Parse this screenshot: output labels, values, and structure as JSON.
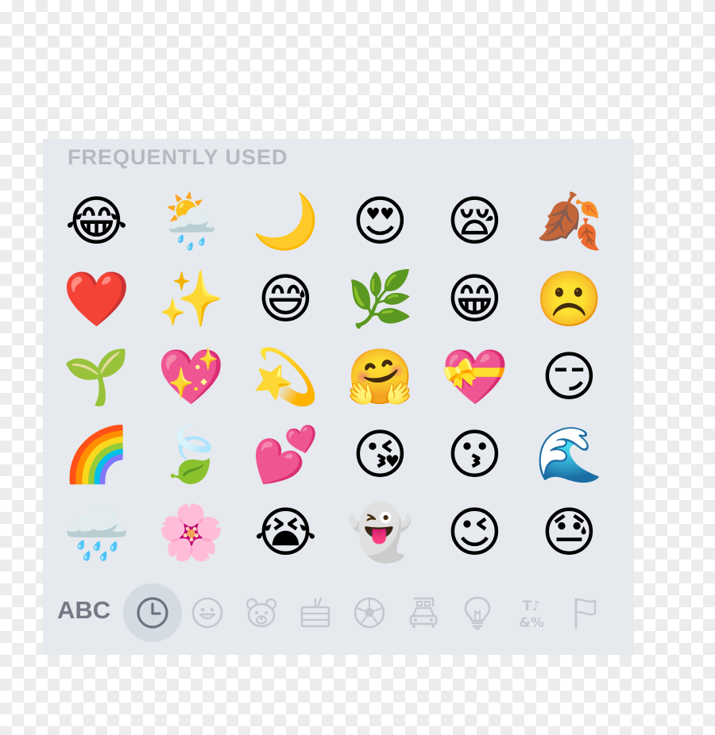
{
  "keyboard": {
    "section_title": "FREQUENTLY USED",
    "emoji_rows": [
      [
        {
          "char": "😂",
          "name": "face-with-tears-of-joy"
        },
        {
          "char": "🌦️",
          "name": "sun-behind-rain-cloud"
        },
        {
          "char": "🌙",
          "name": "crescent-moon"
        },
        {
          "char": "😍",
          "name": "smiling-face-with-heart-eyes"
        },
        {
          "char": "😪",
          "name": "sleepy-face"
        },
        {
          "char": "🍂",
          "name": "fallen-leaf"
        }
      ],
      [
        {
          "char": "❤️",
          "name": "red-heart"
        },
        {
          "char": "✨",
          "name": "sparkles"
        },
        {
          "char": "😅",
          "name": "grinning-face-with-sweat"
        },
        {
          "char": "🌿",
          "name": "herb"
        },
        {
          "char": "😁",
          "name": "beaming-face"
        },
        {
          "char": "☹️",
          "name": "frowning-face"
        }
      ],
      [
        {
          "char": "🌱",
          "name": "seedling"
        },
        {
          "char": "💖",
          "name": "sparkling-heart"
        },
        {
          "char": "💫",
          "name": "dizzy"
        },
        {
          "char": "🤗",
          "name": "hugging-face"
        },
        {
          "char": "💝",
          "name": "heart-with-ribbon"
        },
        {
          "char": "😏",
          "name": "smirking-face"
        }
      ],
      [
        {
          "char": "🌈",
          "name": "rainbow"
        },
        {
          "char": "🍃",
          "name": "leaf-fluttering-in-wind"
        },
        {
          "char": "💕",
          "name": "two-hearts"
        },
        {
          "char": "😘",
          "name": "face-blowing-a-kiss"
        },
        {
          "char": "😗",
          "name": "kissing-face"
        },
        {
          "char": "🌊",
          "name": "water-wave"
        }
      ],
      [
        {
          "char": "🌧️",
          "name": "cloud-with-rain"
        },
        {
          "char": "🌸",
          "name": "cherry-blossom"
        },
        {
          "char": "😭",
          "name": "loudly-crying-face"
        },
        {
          "char": "👻",
          "name": "ghost"
        },
        {
          "char": "😉",
          "name": "winking-face"
        },
        {
          "char": "😓",
          "name": "downcast-face-with-sweat"
        }
      ]
    ],
    "category_bar": {
      "abc_label": "ABC",
      "categories": [
        {
          "icon": "clock-icon",
          "label": "frequently-used",
          "selected": true
        },
        {
          "icon": "smiley-icon",
          "label": "smileys-people",
          "selected": false
        },
        {
          "icon": "bear-icon",
          "label": "animals-nature",
          "selected": false
        },
        {
          "icon": "cake-icon",
          "label": "food-drink",
          "selected": false
        },
        {
          "icon": "soccer-ball-icon",
          "label": "activity",
          "selected": false
        },
        {
          "icon": "car-icon",
          "label": "travel-places",
          "selected": false
        },
        {
          "icon": "lightbulb-icon",
          "label": "objects",
          "selected": false
        },
        {
          "icon": "symbols-icon",
          "label": "symbols",
          "selected": false
        },
        {
          "icon": "flag-icon",
          "label": "flags",
          "selected": false
        }
      ],
      "symbols_icon_text": {
        "top": "T♪",
        "bottom": "&%"
      }
    },
    "colors": {
      "panel_background": "#e6e9ee",
      "title_text": "#b5b9c0",
      "abc_text": "#737a86",
      "selected_icon": "#6a7380",
      "inactive_icon": "#c3c8cf",
      "selected_highlight": "#d4dbe3"
    }
  }
}
